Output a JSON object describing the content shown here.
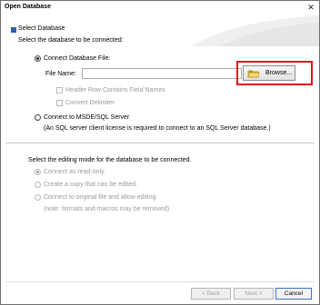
{
  "window": {
    "title": "Open Database",
    "close_glyph": "✕"
  },
  "section": {
    "title": "Select Database",
    "instruction": "Select the database to be connected:"
  },
  "database_file": {
    "label": "Connect Database File:",
    "file_name_label": "File Name:",
    "file_name_value": "",
    "browse_label": "Browse...",
    "header_row_label": "Header Row Contains Field Names",
    "convert_delimiter_label": "Convert Delimiter"
  },
  "sql_server": {
    "label": "Connect to MSDE/SQL Server",
    "note": "(An SQL server client license is required to connect to an SQL Server database.)"
  },
  "editing": {
    "instruction": "Select the editing mode for the database to be connected.",
    "options": [
      "Connect as read-only.",
      "Create a copy that can be edited.",
      "Connect to original file and allow editing."
    ],
    "note": "(note:  formats and macros may be removed)"
  },
  "footer": {
    "back_label": "< Back",
    "next_label": "Next >",
    "cancel_label": "Cancel"
  },
  "colors": {
    "highlight": "#e0141b",
    "section_square": "#2e5fae"
  }
}
